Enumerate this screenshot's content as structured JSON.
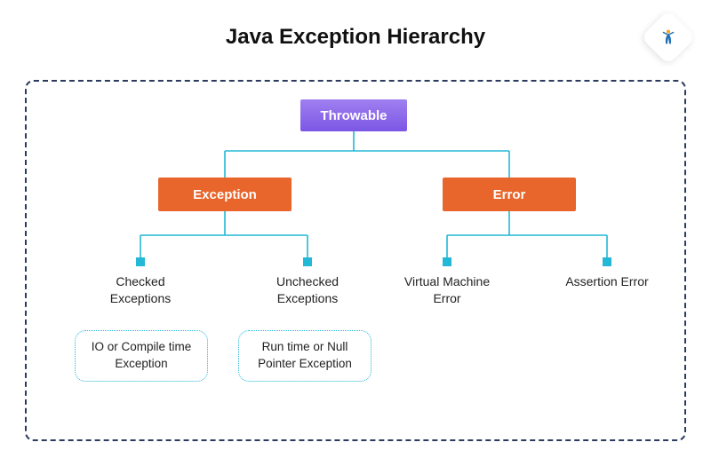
{
  "title": "Java Exception Hierarchy",
  "logo_name": "simplilearn-logo",
  "nodes": {
    "throwable": "Throwable",
    "exception": "Exception",
    "error": "Error",
    "checked": "Checked Exceptions",
    "unchecked": "Unchecked Exceptions",
    "vm_error": "Virtual Machine Error",
    "assertion_error": "Assertion Error"
  },
  "details": {
    "io": "IO or Compile time Exception",
    "runtime": "Run time or Null Pointer Exception"
  },
  "colors": {
    "throwable_bg": "#7c56e4",
    "branch_bg": "#e8652b",
    "connector": "#22b8d6",
    "frame_border": "#2a3b5f"
  }
}
